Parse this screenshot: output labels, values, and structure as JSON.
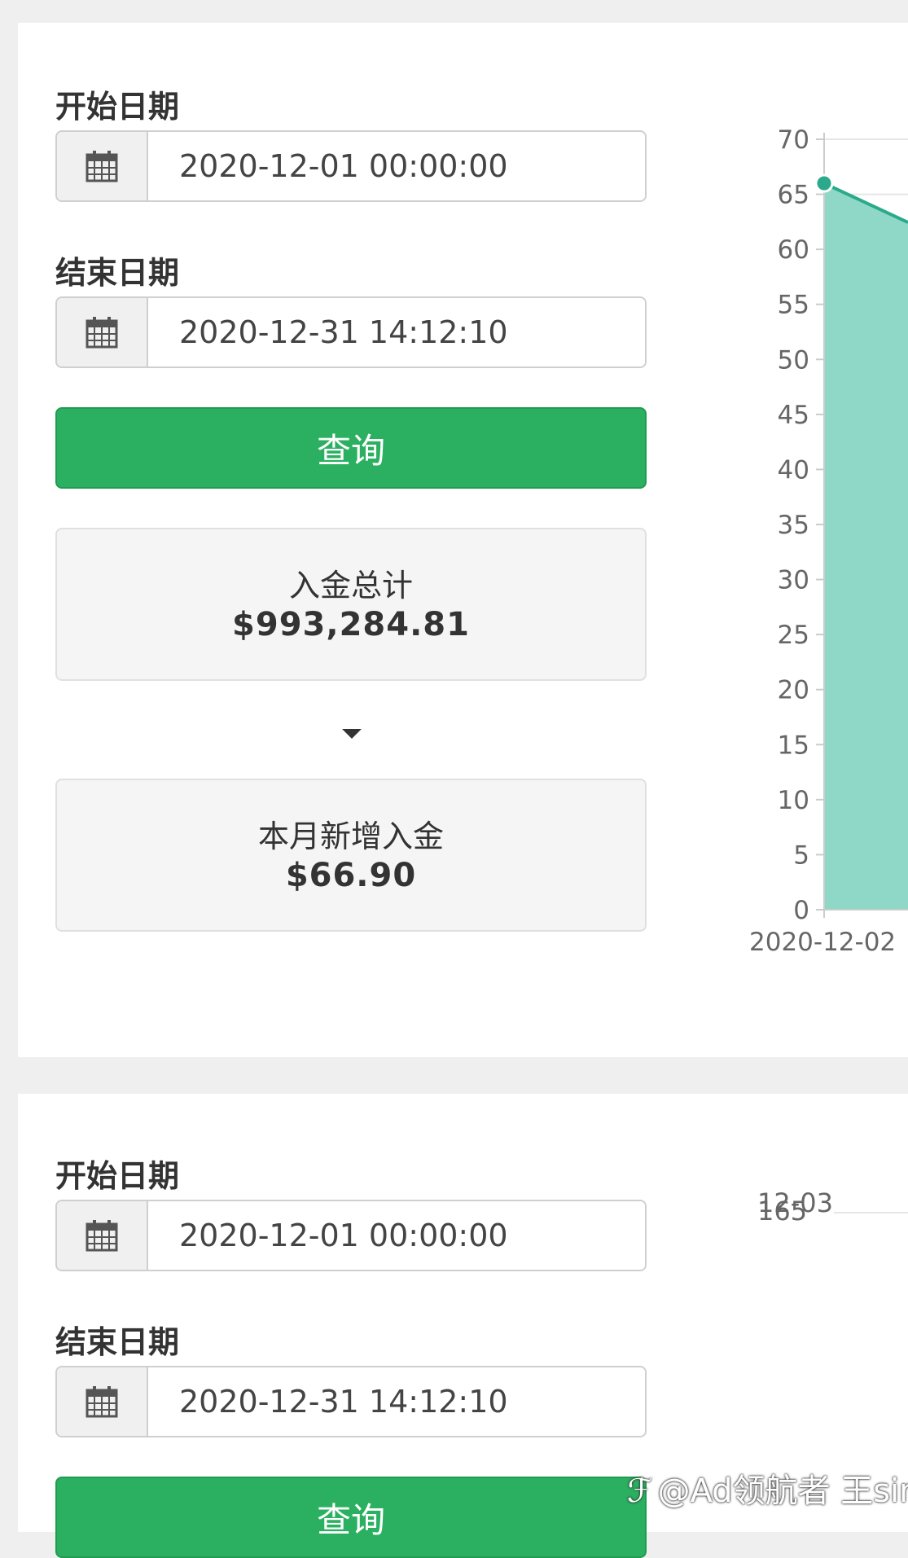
{
  "panel1": {
    "start_label": "开始日期",
    "start_value": "2020-12-01 00:00:00",
    "end_label": "结束日期",
    "end_value": "2020-12-31 14:12:10",
    "query_label": "查询",
    "total": {
      "title": "入金总计",
      "value": "$993,284.81"
    },
    "monthly": {
      "title": "本月新增入金",
      "value": "$66.90"
    }
  },
  "panel2": {
    "start_label": "开始日期",
    "start_value": "2020-12-01 00:00:00",
    "end_label": "结束日期",
    "end_value": "2020-12-31 14:12:10",
    "query_label": "查询",
    "chart_fragment": {
      "tick_labels": [
        "12-03",
        "165"
      ]
    }
  },
  "chart_data": {
    "type": "area",
    "title": "",
    "xlabel": "",
    "ylabel": "",
    "ylim": [
      0,
      70
    ],
    "y_ticks": [
      0,
      5,
      10,
      15,
      20,
      25,
      30,
      35,
      40,
      45,
      50,
      55,
      60,
      65,
      70
    ],
    "x": [
      "2020-12-02"
    ],
    "series": [
      {
        "values": [
          66
        ]
      }
    ],
    "grid": true,
    "colors": {
      "fill": "#8fd8c7",
      "line": "#2aaa8a"
    }
  },
  "watermark": {
    "text": "@Ad领航者 王sir"
  }
}
